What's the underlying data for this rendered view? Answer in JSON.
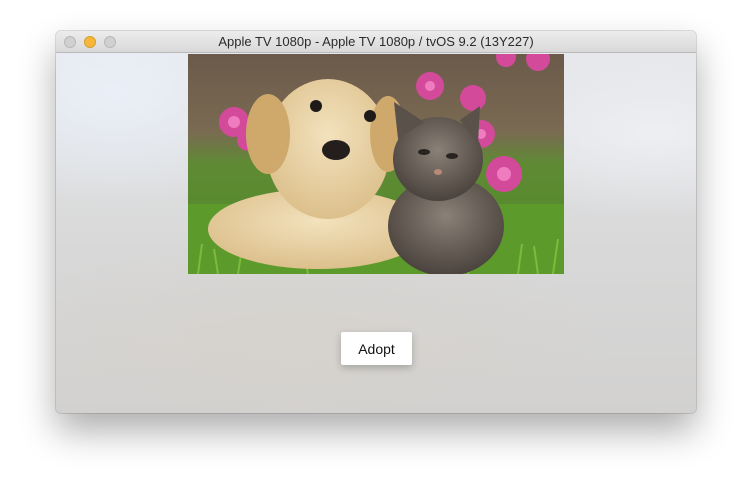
{
  "window": {
    "title": "Apple TV 1080p - Apple TV 1080p / tvOS 9.2 (13Y227)",
    "controls": {
      "close_color": "#d0d0d0",
      "minimize_color": "#f6b73c",
      "zoom_color": "#d0d0d0"
    }
  },
  "main": {
    "image": {
      "subject": "puppy-and-kitten-photo"
    },
    "adopt_button": {
      "label": "Adopt"
    }
  }
}
